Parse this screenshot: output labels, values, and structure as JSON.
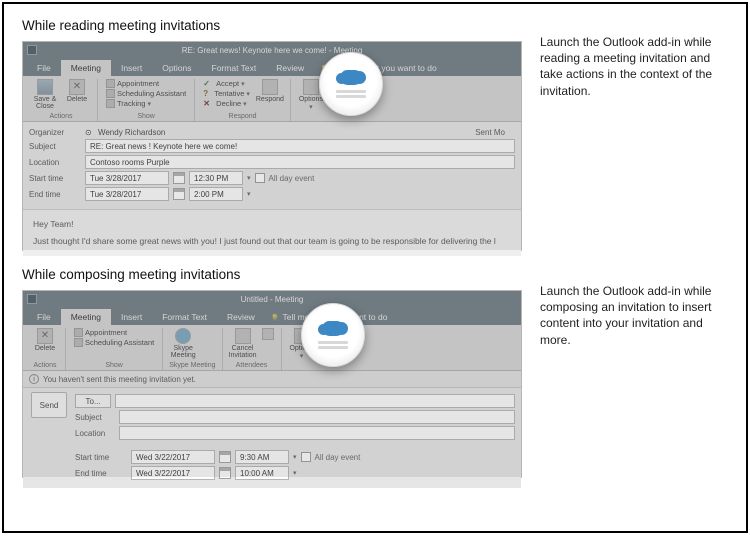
{
  "sections": {
    "reading": {
      "heading": "While reading meeting invitations"
    },
    "composing": {
      "heading": "While composing meeting invitations"
    }
  },
  "captions": {
    "reading": "Launch the Outlook add-in while reading a meeting invitation and take actions in the context of the invitation.",
    "composing": "Launch the Outlook add-in while composing an invitation to insert content into your invitation and more."
  },
  "outlook_reading": {
    "window_title": "RE: Great news! Keynote here we come! - Meeting",
    "tabs": {
      "file": "File",
      "meeting": "Meeting",
      "insert": "Insert",
      "options": "Options",
      "format_text": "Format Text",
      "review": "Review",
      "tell": "Tell me what you want to do"
    },
    "ribbon": {
      "actions": {
        "save_close": "Save &\nClose",
        "delete": "Delete",
        "group": "Actions"
      },
      "show": {
        "appointment": "Appointment",
        "scheduling": "Scheduling Assistant",
        "tracking": "Tracking",
        "group": "Show"
      },
      "respond": {
        "accept": "Accept",
        "tentative": "Tentative",
        "decline": "Decline",
        "respond": "Respond",
        "group": "Respond"
      },
      "options": "Options"
    },
    "fields": {
      "organizer_label": "Organizer",
      "organizer": "Wendy Richardson",
      "subject_label": "Subject",
      "subject": "RE: Great news ! Keynote here we come!",
      "location_label": "Location",
      "location": "Contoso rooms  Purple",
      "start_label": "Start time",
      "start_date": "Tue 3/28/2017",
      "start_time": "12:30 PM",
      "end_label": "End time",
      "end_date": "Tue 3/28/2017",
      "end_time": "2:00 PM",
      "allday": "All day event",
      "sent": "Sent   Mo"
    },
    "body": {
      "greeting": "Hey Team!",
      "line1": "Just thought I'd share some great news with you! I just found out that our team is going to be responsible for delivering the l"
    }
  },
  "outlook_compose": {
    "window_title": "Untitled - Meeting",
    "tabs": {
      "file": "File",
      "meeting": "Meeting",
      "insert": "Insert",
      "format_text": "Format Text",
      "review": "Review",
      "tell": "Tell me what you want to do"
    },
    "ribbon": {
      "actions": {
        "delete": "Delete",
        "group": "Actions"
      },
      "show": {
        "appointment": "Appointment",
        "scheduling": "Scheduling Assistant",
        "group": "Show"
      },
      "skype": {
        "label": "Skype\nMeeting",
        "group": "Skype Meeting"
      },
      "attendees": {
        "cancel": "Cancel\nInvitation",
        "group": "Attendees"
      },
      "options": "Options"
    },
    "info_bar": "You haven't sent this meeting invitation yet.",
    "send": {
      "label": "Send",
      "to": "To...",
      "subject_label": "Subject",
      "location_label": "Location"
    },
    "fields": {
      "start_label": "Start time",
      "start_date": "Wed 3/22/2017",
      "start_time": "9:30 AM",
      "end_label": "End time",
      "end_date": "Wed 3/22/2017",
      "end_time": "10:00 AM",
      "allday": "All day event"
    }
  }
}
